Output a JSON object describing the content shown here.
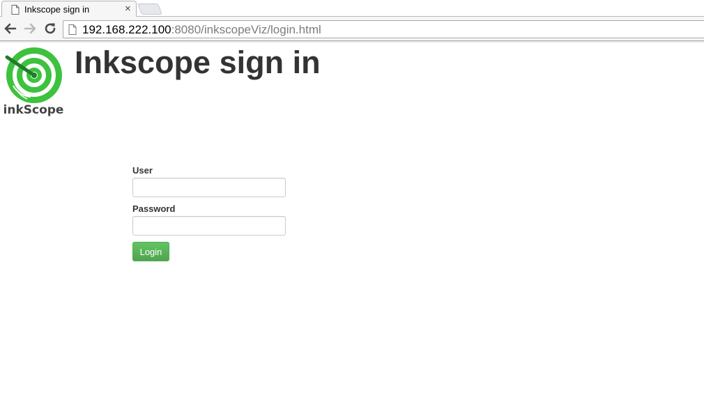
{
  "browser": {
    "tab_title": "Inkscope sign in",
    "tab_close": "×",
    "url_host": "192.168.222.100",
    "url_rest": ":8080/inkscopeViz/login.html"
  },
  "page": {
    "logo_text": "inkScope",
    "title": "Inkscope sign in"
  },
  "form": {
    "user_label": "User",
    "user_value": "",
    "password_label": "Password",
    "password_value": "",
    "login_button": "Login"
  },
  "colors": {
    "logo_green": "#3dc23d",
    "button_green": "#5cb85c",
    "title_text": "#333333"
  }
}
